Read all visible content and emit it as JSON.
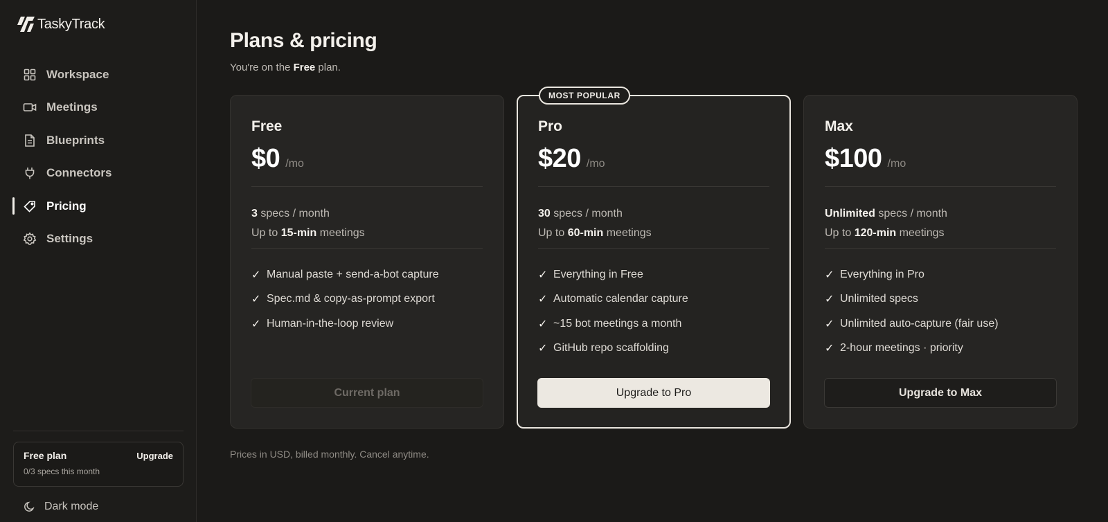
{
  "brand": {
    "name": "TaskyTrack"
  },
  "sidebar": {
    "items": [
      {
        "label": "Workspace",
        "icon": "grid-icon"
      },
      {
        "label": "Meetings",
        "icon": "video-icon"
      },
      {
        "label": "Blueprints",
        "icon": "document-icon"
      },
      {
        "label": "Connectors",
        "icon": "plug-icon"
      },
      {
        "label": "Pricing",
        "icon": "tag-icon",
        "active": true
      },
      {
        "label": "Settings",
        "icon": "gear-icon"
      }
    ],
    "plan_box": {
      "plan_name": "Free plan",
      "upgrade_label": "Upgrade",
      "usage": "0/3 specs this month"
    },
    "dark_mode_label": "Dark mode"
  },
  "header": {
    "title": "Plans & pricing",
    "subtitle_prefix": "You're on the ",
    "subtitle_plan": "Free",
    "subtitle_suffix": " plan."
  },
  "plans": [
    {
      "name": "Free",
      "price": "$0",
      "period": "/mo",
      "specs_value": "3",
      "specs_suffix": " specs / month",
      "meetings_prefix": "Up to ",
      "meetings_value": "15-min",
      "meetings_suffix": " meetings",
      "features": [
        "Manual paste + send-a-bot capture",
        "Spec.md & copy-as-prompt export",
        "Human-in-the-loop review"
      ],
      "cta": "Current plan"
    },
    {
      "name": "Pro",
      "badge": "MOST POPULAR",
      "price": "$20",
      "period": "/mo",
      "specs_value": "30",
      "specs_suffix": " specs / month",
      "meetings_prefix": "Up to ",
      "meetings_value": "60-min",
      "meetings_suffix": " meetings",
      "features": [
        "Everything in Free",
        "Automatic calendar capture",
        "~15 bot meetings a month",
        "GitHub repo scaffolding"
      ],
      "cta": "Upgrade to Pro"
    },
    {
      "name": "Max",
      "price": "$100",
      "period": "/mo",
      "specs_value": "Unlimited",
      "specs_suffix": " specs / month",
      "meetings_prefix": "Up to ",
      "meetings_value": "120-min",
      "meetings_suffix": " meetings",
      "features": [
        "Everything in Pro",
        "Unlimited specs",
        "Unlimited auto-capture (fair use)",
        "2-hour meetings · priority"
      ],
      "cta": "Upgrade to Max"
    }
  ],
  "check_glyph": "✓",
  "footnote": "Prices in USD, billed monthly. Cancel anytime."
}
